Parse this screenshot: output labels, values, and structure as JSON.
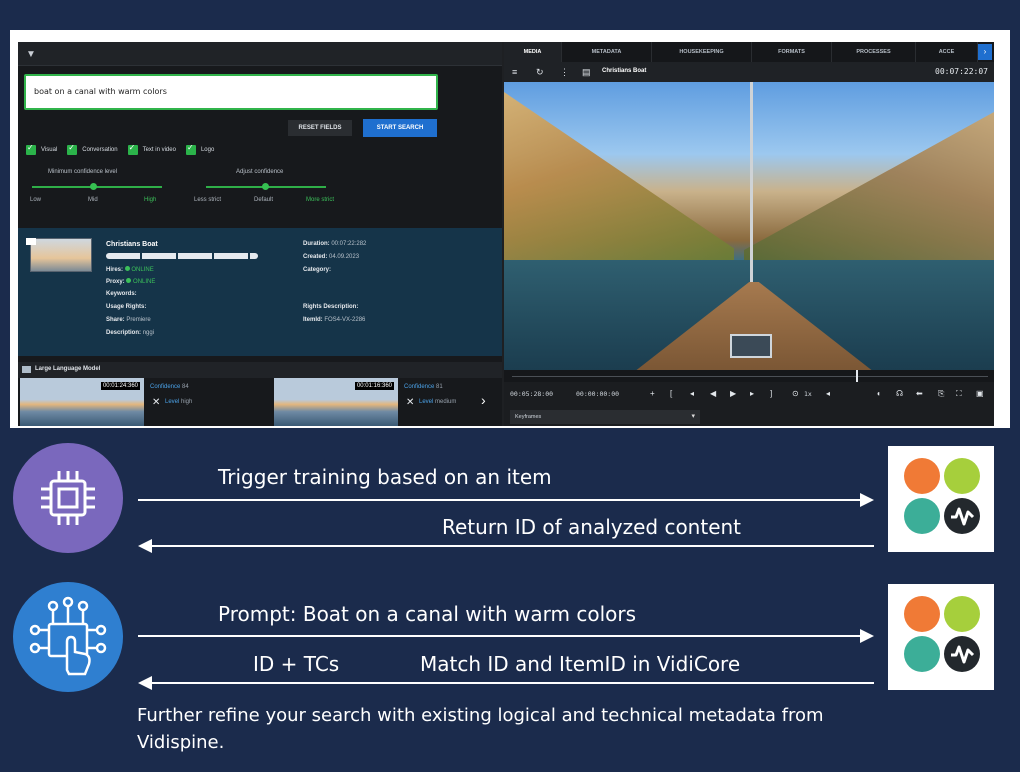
{
  "screenshot": {
    "search": {
      "query": "boat on a canal with warm colors"
    },
    "buttons": {
      "reset": "RESET FIELDS",
      "start": "START SEARCH"
    },
    "checkboxes": [
      "Visual",
      "Conversation",
      "Text in video",
      "Logo"
    ],
    "sliders": {
      "min_confidence": {
        "label": "Minimum confidence level",
        "ticks": [
          "Low",
          "Mid",
          "High"
        ],
        "level": 0.5
      },
      "adjust_confidence": {
        "label": "Adjust confidence",
        "ticks": [
          "Less strict",
          "Default",
          "More strict"
        ],
        "level": 0.5
      }
    },
    "result": {
      "title": "Christians Boat",
      "hires_label": "Hires:",
      "hires_value": "ONLINE",
      "proxy_label": "Proxy:",
      "proxy_value": "ONLINE",
      "keywords_label": "Keywords:",
      "usage_label": "Usage Rights:",
      "share_label": "Share:",
      "share_value": "Premiere",
      "description_label": "Description:",
      "description_value": "nggi",
      "duration_label": "Duration:",
      "duration_value": "00:07:22:282",
      "created_label": "Created:",
      "created_value": "04.09.2023",
      "category_label": "Category:",
      "rights_label": "Rights Description:",
      "itemid_label": "ItemId:",
      "itemid_value": "FOS4-VX-2286"
    },
    "llm": {
      "label": "Large Language Model"
    },
    "clips": [
      {
        "timecode": "00:01:24:360",
        "confidence_label": "Confidence",
        "confidence": "84",
        "level_label": "Level",
        "level": "high"
      },
      {
        "timecode": "00:01:16:360",
        "confidence_label": "Confidence",
        "confidence": "81",
        "level_label": "Level",
        "level": "medium"
      }
    ],
    "tabs": [
      "MEDIA",
      "METADATA",
      "HOUSEKEEPING",
      "FORMATS",
      "PROCESSES",
      "ACCE"
    ],
    "player": {
      "title": "Christians Boat",
      "time": "00:07:22:07",
      "current": "00:05:28:00",
      "in_point": "00:00:00:00",
      "speed": "1x",
      "keyframes": "Keyframes"
    }
  },
  "diagram": {
    "step1": {
      "forward": "Trigger training based on an item",
      "back": "Return ID of analyzed content",
      "icon": "chip-icon"
    },
    "step2": {
      "forward": "Prompt: Boat on a canal with warm colors",
      "back_left": "ID + TCs",
      "back_right": "Match ID and ItemID in VidiCore",
      "icon": "touch-circuit-icon"
    },
    "note": "Further refine your search with existing logical and technical metadata from Vidispine.",
    "colors": {
      "background": "#1b2b4c",
      "purple": "#7a68bd",
      "blue": "#2f7fd0",
      "orange": "#f07a36",
      "green": "#a6cf3c",
      "teal": "#3cae98",
      "dark": "#23282d"
    }
  }
}
